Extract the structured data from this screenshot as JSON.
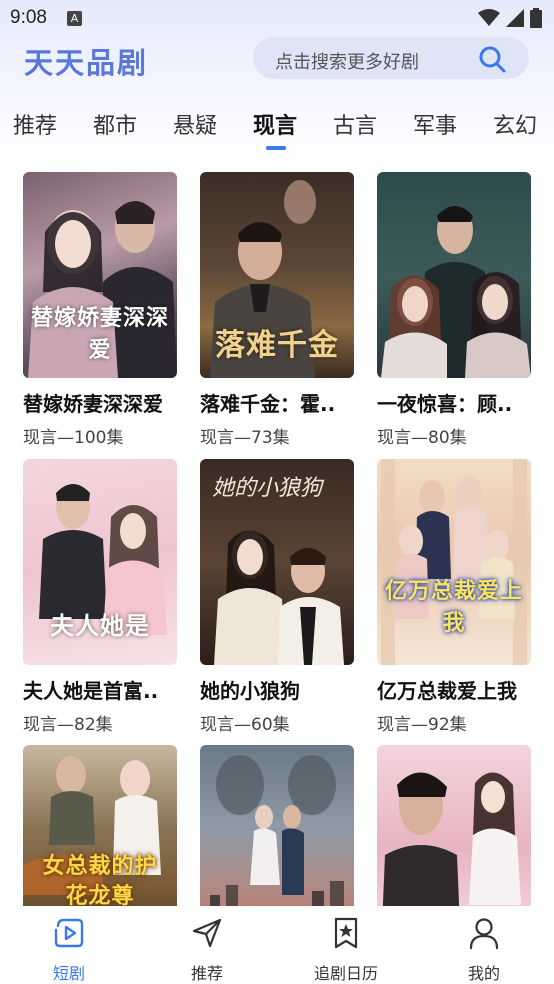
{
  "status_bar": {
    "time": "9:08",
    "notif_glyph": "A"
  },
  "header": {
    "app_title": "天天品剧",
    "search_placeholder": "点击搜索更多好剧",
    "search_icon": "search-icon"
  },
  "tabs": [
    {
      "label": "推荐"
    },
    {
      "label": "都市"
    },
    {
      "label": "悬疑"
    },
    {
      "label": "现言",
      "active": true
    },
    {
      "label": "古言"
    },
    {
      "label": "军事"
    },
    {
      "label": "玄幻"
    }
  ],
  "cards": [
    {
      "title": "替嫁娇妻深深爱",
      "sub": "现言—100集",
      "caption": "替嫁娇妻深深爱"
    },
    {
      "title": "落难千金：霍..",
      "sub": "现言—73集",
      "caption": "落难千金"
    },
    {
      "title": "一夜惊喜：顾..",
      "sub": "现言—80集",
      "caption": ""
    },
    {
      "title": "夫人她是首富..",
      "sub": "现言—82集",
      "caption": "夫人她是"
    },
    {
      "title": "她的小狼狗",
      "sub": "现言—60集",
      "caption": ""
    },
    {
      "title": "亿万总裁爱上我",
      "sub": "现言—92集",
      "caption": "亿万总裁爱上我"
    },
    {
      "title": "",
      "sub": "",
      "caption": "女总裁的护花龙尊"
    },
    {
      "title": "",
      "sub": "",
      "caption": ""
    },
    {
      "title": "",
      "sub": "",
      "caption": ""
    }
  ],
  "bottom_nav": [
    {
      "label": "短剧",
      "icon": "play-icon",
      "active": true
    },
    {
      "label": "推荐",
      "icon": "send-icon"
    },
    {
      "label": "追剧日历",
      "icon": "bookmark-star-icon"
    },
    {
      "label": "我的",
      "icon": "user-icon"
    }
  ],
  "colors": {
    "accent": "#3a78ee",
    "brand_title": "#5a78dc"
  }
}
